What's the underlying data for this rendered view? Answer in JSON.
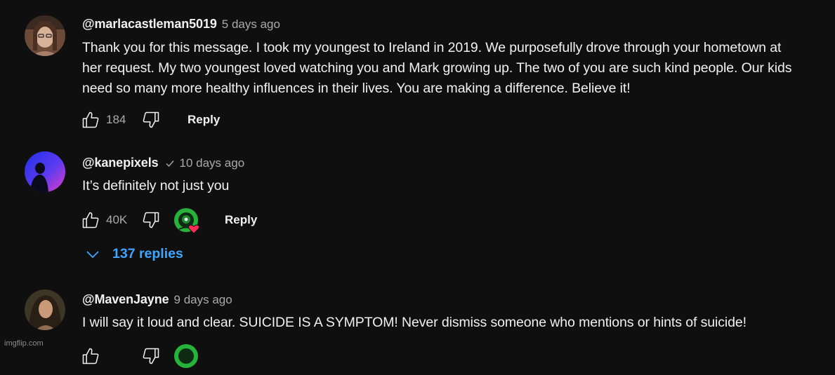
{
  "comments": [
    {
      "handle": "@marlacastleman5019",
      "time": "5 days ago",
      "text_lines": [
        "Thank you for this message. I took my youngest to Ireland in 2019. We purposefully drove through your hometown at",
        "her request. My two youngest loved watching you and Mark growing up. The two of you are such kind people. Our kids",
        "need so many more healthy influences in their lives. You are making a difference. Believe it!"
      ],
      "likes": "184",
      "reply_label": "Reply",
      "icons": {
        "like": "thumbs-up-icon",
        "dislike": "thumbs-down-icon"
      }
    },
    {
      "handle": "@kanepixels",
      "verified": true,
      "time": "10 days ago",
      "text_lines": [
        "It’s definitely not just you"
      ],
      "likes": "40K",
      "reply_label": "Reply",
      "creator_heart": true,
      "icons": {
        "like": "thumbs-up-icon",
        "dislike": "thumbs-down-icon",
        "heart": "creator-heart-icon",
        "verified": "verified-check-icon"
      }
    },
    {
      "handle": "@MavenJayne",
      "time": "9 days ago",
      "text_lines": [
        "I will say it loud and clear. SUICIDE IS A SYMPTOM! Never dismiss someone who mentions or hints of suicide!"
      ]
    }
  ],
  "replies_toggle": {
    "label": "137 replies",
    "icon": "chevron-down-icon"
  },
  "watermark": "imgflip.com",
  "colors": {
    "background": "#0f0f0f",
    "text": "#f1f1f1",
    "secondary": "#aaaaaa",
    "link": "#3ea6ff",
    "heart": "#ff2d55",
    "creator_avatar": "#27b33a"
  }
}
